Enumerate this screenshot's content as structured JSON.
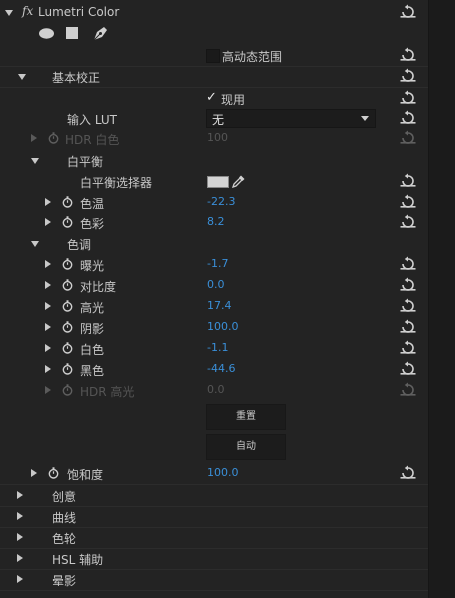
{
  "header": {
    "fx": "fx",
    "title": "Lumetri Color"
  },
  "tools": [
    "ellipse-mask-tool",
    "rectangle-mask-tool",
    "pen-mask-tool"
  ],
  "hdr_range": {
    "label": "高动态范围",
    "checked": false
  },
  "basic": {
    "title": "基本校正",
    "apply": {
      "check": "✓",
      "label": "现用"
    },
    "input_lut": {
      "label": "输入 LUT",
      "value": "无"
    },
    "hdr_white": {
      "label": "HDR 白色",
      "value": "100"
    },
    "white_balance": {
      "title": "白平衡",
      "selector_label": "白平衡选择器",
      "temperature": {
        "label": "色温",
        "value": "-22.3"
      },
      "tint": {
        "label": "色彩",
        "value": "8.2"
      }
    },
    "tone": {
      "title": "色调",
      "exposure": {
        "label": "曝光",
        "value": "-1.7"
      },
      "contrast": {
        "label": "对比度",
        "value": "0.0"
      },
      "highlights": {
        "label": "高光",
        "value": "17.4"
      },
      "shadows": {
        "label": "阴影",
        "value": "100.0"
      },
      "whites": {
        "label": "白色",
        "value": "-1.1"
      },
      "blacks": {
        "label": "黑色",
        "value": "-44.6"
      },
      "hdr_specular": {
        "label": "HDR 高光",
        "value": "0.0"
      },
      "reset_button": "重置",
      "auto_button": "自动"
    },
    "saturation": {
      "label": "饱和度",
      "value": "100.0"
    }
  },
  "sections": {
    "creative": "创意",
    "curves": "曲线",
    "color_wheels": "色轮",
    "hsl": "HSL 辅助",
    "vignette": "晕影"
  },
  "colors": {
    "value": "#3a8fd8",
    "panel": "#232323",
    "text": "#c8c8c8"
  }
}
